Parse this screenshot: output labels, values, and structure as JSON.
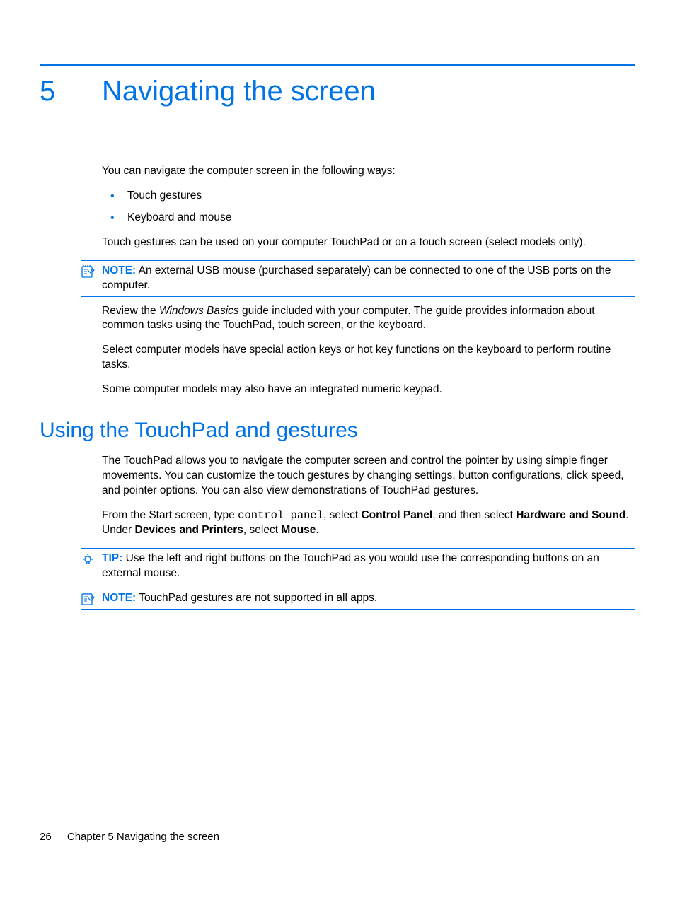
{
  "chapter": {
    "number": "5",
    "title": "Navigating the screen"
  },
  "intro": "You can navigate the computer screen in the following ways:",
  "bullets": [
    "Touch gestures",
    "Keyboard and mouse"
  ],
  "p_touch": "Touch gestures can be used on your computer TouchPad or on a touch screen (select models only).",
  "note1": {
    "label": "NOTE:",
    "text": "An external USB mouse (purchased separately) can be connected to one of the USB ports on the computer."
  },
  "p_review_a": "Review the ",
  "p_review_italic": "Windows Basics",
  "p_review_b": " guide included with your computer. The guide provides information about common tasks using the TouchPad, touch screen, or the keyboard.",
  "p_select": "Select computer models have special action keys or hot key functions on the keyboard to perform routine tasks.",
  "p_some": "Some computer models may also have an integrated numeric keypad.",
  "section1": "Using the TouchPad and gestures",
  "p_touchpad": "The TouchPad allows you to navigate the computer screen and control the pointer by using simple finger movements. You can customize the touch gestures by changing settings, button configurations, click speed, and pointer options. You can also view demonstrations of TouchPad gestures.",
  "p_start_a": "From the Start screen, type ",
  "p_start_code": "control panel",
  "p_start_b": ", select ",
  "p_start_bold1": "Control Panel",
  "p_start_c": ", and then select ",
  "p_start_bold2": "Hardware and Sound",
  "p_start_d": ". Under ",
  "p_start_bold3": "Devices and Printers",
  "p_start_e": ", select ",
  "p_start_bold4": "Mouse",
  "p_start_f": ".",
  "tip": {
    "label": "TIP:",
    "text": "Use the left and right buttons on the TouchPad as you would use the corresponding buttons on an external mouse."
  },
  "note2": {
    "label": "NOTE:",
    "text": "TouchPad gestures are not supported in all apps."
  },
  "footer": {
    "page": "26",
    "text": "Chapter 5   Navigating the screen"
  }
}
